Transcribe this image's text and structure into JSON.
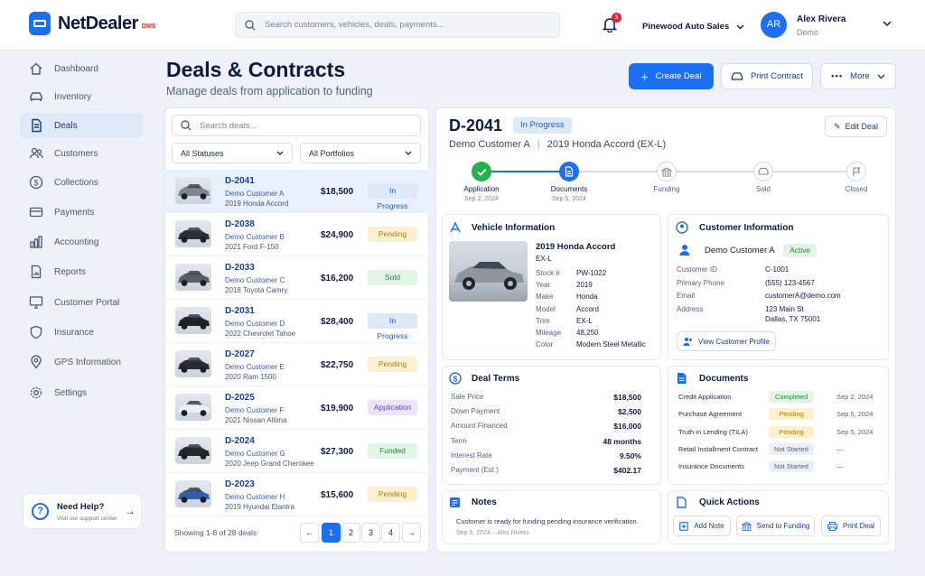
{
  "app": {
    "name": "NetDealer",
    "suffix": "DMS"
  },
  "search": {
    "placeholder": "Search customers, vehicles, deals, payments..."
  },
  "notifications": {
    "count": "3"
  },
  "dealer": {
    "name": "Pinewood Auto Sales"
  },
  "user": {
    "initials": "AR",
    "name": "Alex Rivera",
    "role": "Demo"
  },
  "nav": [
    {
      "label": "Dashboard",
      "icon": "home-icon"
    },
    {
      "label": "Inventory",
      "icon": "car-icon"
    },
    {
      "label": "Deals",
      "icon": "document-icon",
      "active": true
    },
    {
      "label": "Customers",
      "icon": "users-icon"
    },
    {
      "label": "Collections",
      "icon": "dollar-icon"
    },
    {
      "label": "Payments",
      "icon": "card-icon"
    },
    {
      "label": "Accounting",
      "icon": "bar-chart-icon"
    },
    {
      "label": "Reports",
      "icon": "report-icon"
    },
    {
      "label": "Customer Portal",
      "icon": "monitor-icon"
    },
    {
      "label": "Insurance",
      "icon": "shield-icon"
    },
    {
      "label": "GPS Information",
      "icon": "location-pin-icon"
    },
    {
      "label": "Settings",
      "icon": "gear-icon"
    }
  ],
  "help": {
    "title": "Need Help?",
    "subtitle": "Visit our support center"
  },
  "page": {
    "title": "Deals & Contracts",
    "subtitle": "Manage deals from application to funding"
  },
  "actions": {
    "create": "Create Deal",
    "print": "Print Contract",
    "more": "More"
  },
  "list": {
    "search_placeholder": "Search deals...",
    "status_filter": "All Statuses",
    "portfolio_filter": "All Portfolios",
    "deals": [
      {
        "id": "D-2041",
        "customer": "Demo Customer A",
        "vehicle": "2019 Honda Accord",
        "amount": "$18,500",
        "status": "In Progress",
        "kind": "progress",
        "color": "#7d8590"
      },
      {
        "id": "D-2038",
        "customer": "Demo Customer B",
        "vehicle": "2021 Ford F-150",
        "amount": "$24,900",
        "status": "Pending",
        "kind": "pending",
        "color": "#2b2f36"
      },
      {
        "id": "D-2033",
        "customer": "Demo Customer C",
        "vehicle": "2018 Toyota Camry",
        "amount": "$16,200",
        "status": "Sold",
        "kind": "sold",
        "color": "#5a5f66"
      },
      {
        "id": "D-2031",
        "customer": "Demo Customer D",
        "vehicle": "2022 Chevrolet Tahoe",
        "amount": "$28,400",
        "status": "In Progress",
        "kind": "progress",
        "color": "#1f2227"
      },
      {
        "id": "D-2027",
        "customer": "Demo Customer E",
        "vehicle": "2020 Ram 1500",
        "amount": "$22,750",
        "status": "Pending",
        "kind": "pending",
        "color": "#2a2c30"
      },
      {
        "id": "D-2025",
        "customer": "Demo Customer F",
        "vehicle": "2021 Nissan Altima",
        "amount": "$19,900",
        "status": "Application",
        "kind": "application",
        "color": "#eef0f3"
      },
      {
        "id": "D-2024",
        "customer": "Demo Customer G",
        "vehicle": "2020 Jeep Grand Cherokee",
        "amount": "$27,300",
        "status": "Funded",
        "kind": "funded",
        "color": "#25272b"
      },
      {
        "id": "D-2023",
        "customer": "Demo Customer H",
        "vehicle": "2019 Hyundai Elantra",
        "amount": "$15,600",
        "status": "Pending",
        "kind": "pending",
        "color": "#2f5fa8"
      }
    ],
    "pagination": {
      "summary": "Showing 1-8 of 28 deals",
      "pages": [
        "1",
        "2",
        "3",
        "4"
      ],
      "prev": "←",
      "next": "→"
    }
  },
  "detail": {
    "id": "D-2041",
    "status": "In Progress",
    "customer": "Demo Customer A",
    "vehicle": "2019 Honda Accord (EX-L)",
    "edit": "Edit Deal",
    "steps": [
      {
        "label": "Application",
        "date": "Sep 2, 2024",
        "state": "done"
      },
      {
        "label": "Documents",
        "date": "Sep 5, 2024",
        "state": "current"
      },
      {
        "label": "Funding",
        "date": "",
        "state": "todo"
      },
      {
        "label": "Sold",
        "date": "",
        "state": "todo"
      },
      {
        "label": "Closed",
        "date": "",
        "state": "todo"
      }
    ],
    "vehicle_info": {
      "title": "Vehicle Information",
      "name": "2019 Honda Accord",
      "trim_line": "EX-L",
      "fields": [
        [
          "Stock #",
          "PW-1022"
        ],
        [
          "Year",
          "2019"
        ],
        [
          "Make",
          "Honda"
        ],
        [
          "Model",
          "Accord"
        ],
        [
          "Trim",
          "EX-L"
        ],
        [
          "Mileage",
          "48,250"
        ],
        [
          "Color",
          "Modern Steel Metallic"
        ]
      ]
    },
    "customer_info": {
      "title": "Customer Information",
      "name": "Demo Customer A",
      "status": "Active",
      "fields": [
        [
          "Customer ID",
          "C-1001"
        ],
        [
          "Primary Phone",
          "(555) 123-4567"
        ],
        [
          "Email",
          "customerA@demo.com"
        ],
        [
          "Address",
          "123 Main St"
        ],
        [
          "",
          "Dallas, TX 75001"
        ]
      ],
      "view_button": "View Customer Profile"
    },
    "deal_terms": {
      "title": "Deal Terms",
      "fields": [
        [
          "Sale Price",
          "$18,500"
        ],
        [
          "Down Payment",
          "$2,500"
        ],
        [
          "Amount Financed",
          "$16,000"
        ],
        [
          "Term",
          "48 months"
        ],
        [
          "Interest Rate",
          "9.50%"
        ],
        [
          "Payment (Est.)",
          "$402.17"
        ]
      ]
    },
    "documents": {
      "title": "Documents",
      "items": [
        {
          "name": "Credit Application",
          "status": "Completed",
          "kind": "completed",
          "date": "Sep 2, 2024"
        },
        {
          "name": "Purchase Agreement",
          "status": "Pending",
          "kind": "pending",
          "date": "Sep 5, 2024"
        },
        {
          "name": "Truth in Lending (TILA)",
          "status": "Pending",
          "kind": "pending",
          "date": "Sep 5, 2024"
        },
        {
          "name": "Retail Installment Contract",
          "status": "Not Started",
          "kind": "notstarted",
          "date": "—"
        },
        {
          "name": "Insurance Documents",
          "status": "Not Started",
          "kind": "notstarted",
          "date": "—"
        }
      ]
    },
    "notes": {
      "title": "Notes",
      "text": "Customer is ready for funding pending insurance verification.",
      "meta": "Sep 5, 2024 – Alex Rivers"
    },
    "quick_actions": {
      "title": "Quick Actions",
      "add_note": "Add Note",
      "send": "Send to Funding",
      "print": "Print Deal"
    }
  },
  "colors": {
    "accent": "#1d6ff2",
    "brand_red": "#e1262f",
    "done_green": "#22b14c"
  }
}
